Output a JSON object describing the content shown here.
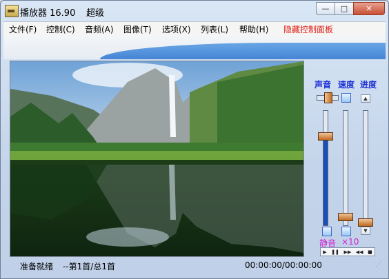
{
  "window": {
    "title": "播放器 16.90",
    "title_extra": "超级",
    "minimize": "—",
    "maximize": "□",
    "close": "✕"
  },
  "menu": {
    "items": [
      {
        "label": "文件(F)"
      },
      {
        "label": "控制(C)"
      },
      {
        "label": "音频(A)"
      },
      {
        "label": "图像(T)"
      },
      {
        "label": "选项(X)"
      },
      {
        "label": "列表(L)"
      },
      {
        "label": "帮助(H)"
      }
    ],
    "hide_panel": "隐藏控制面板",
    "hide_panel_color": "#e0201a"
  },
  "controls": {
    "volume_label": "声音",
    "speed_label": "速度",
    "progress_label": "进度",
    "volume_level": 0.8,
    "speed_level": 0.05,
    "progress_level": 0.0,
    "mute_label": "静音",
    "speed_multiplier": "×10",
    "label_color": "#1b2fd6",
    "accent_color": "#d020d0",
    "playback_buttons": [
      {
        "icon": "play-icon",
        "glyph": "▶"
      },
      {
        "icon": "pause-icon",
        "glyph": "❚❚"
      },
      {
        "icon": "fast-forward-icon",
        "glyph": "▶▶"
      },
      {
        "icon": "rewind-icon",
        "glyph": "◀◀"
      },
      {
        "icon": "stop-icon",
        "glyph": "■"
      }
    ]
  },
  "status": {
    "state": "准备就绪",
    "track_info": "--第1首/总1首",
    "time": "00:00:00/00:00:00"
  }
}
